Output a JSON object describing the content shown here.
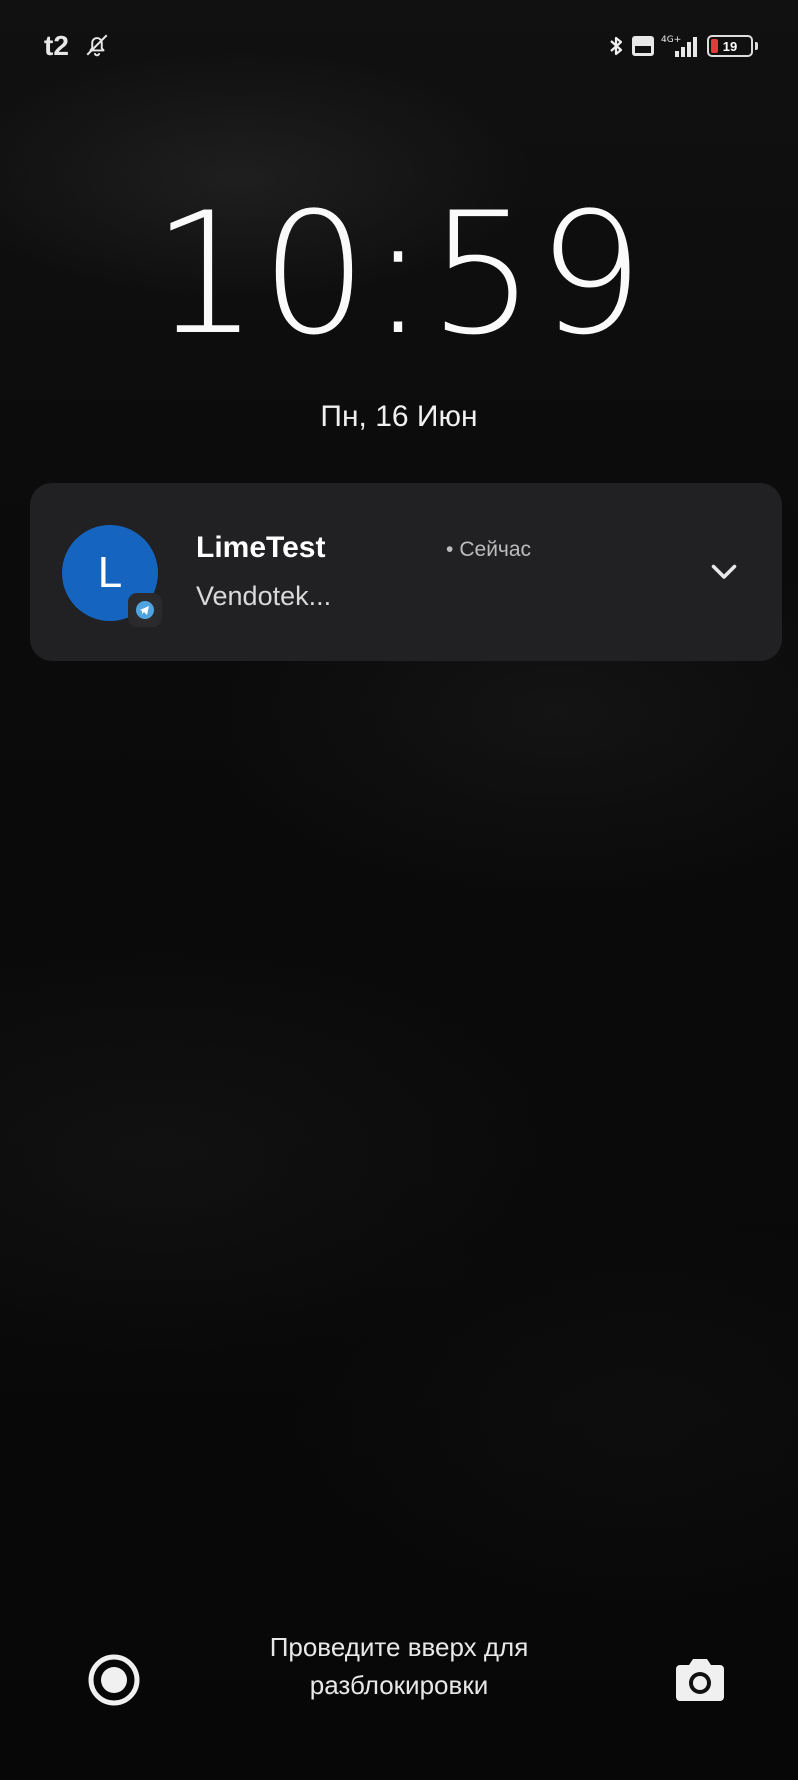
{
  "status_bar": {
    "carrier": "t2",
    "icons": {
      "left": [
        "bell-off-icon"
      ],
      "right": [
        "bluetooth-icon",
        "volte-icon",
        "signal-4g-icon",
        "battery-icon"
      ]
    },
    "network_label": "4G+",
    "battery_level": 19,
    "battery_color": "#e23b3b"
  },
  "lock_screen": {
    "time": "10:59",
    "date": "Пн, 16 Июн"
  },
  "notification": {
    "avatar_letter": "L",
    "avatar_color": "#1565c0",
    "app_badge_icon": "telegram-icon",
    "title": "LimeTest",
    "time_separator": "•",
    "time": "Сейчас",
    "body": "Vendotek..."
  },
  "bottom": {
    "unlock_hint_line1": "Проведите вверх для",
    "unlock_hint_line2": "разблокировки",
    "left_shortcut_icon": "circle-shortcut-icon",
    "right_shortcut_icon": "camera-icon"
  }
}
